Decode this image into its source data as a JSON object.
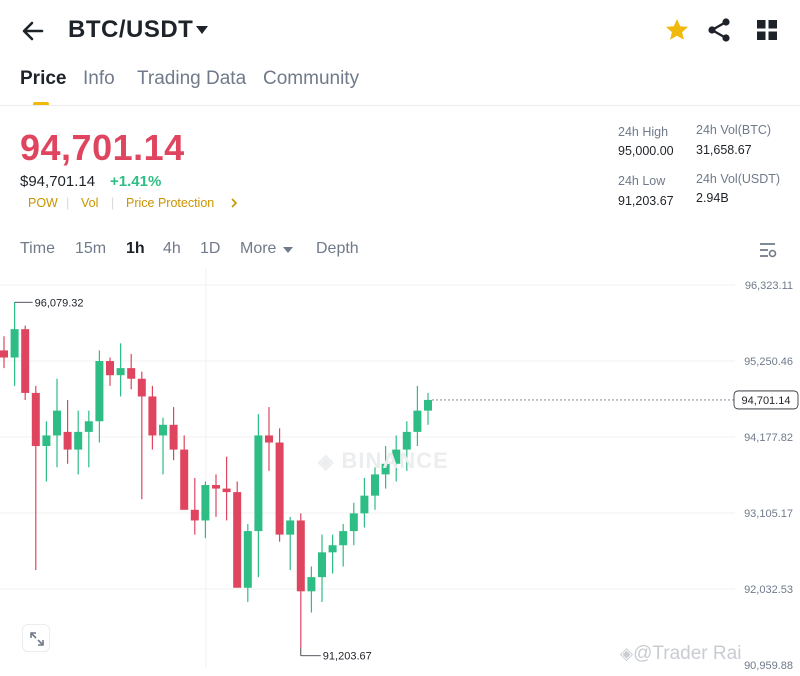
{
  "header": {
    "pair": "BTC/USDT",
    "back_icon": "arrow-left-icon",
    "favorite_icon": "star-icon",
    "favorite_color": "#f0b90b",
    "share_icon": "share-icon",
    "menu_icon": "grid-icon"
  },
  "tabs": [
    "Price",
    "Info",
    "Trading Data",
    "Community"
  ],
  "active_tab": "Price",
  "price": {
    "last": "94,701.14",
    "usd": "$94,701.14",
    "change": "+1.41%",
    "tags": [
      "POW",
      "Vol",
      "Price Protection"
    ]
  },
  "stats": {
    "high_label": "24h High",
    "high_value": "95,000.00",
    "vol_btc_label": "24h Vol(BTC)",
    "vol_btc_value": "31,658.67",
    "low_label": "24h Low",
    "low_value": "91,203.67",
    "vol_usdt_label": "24h Vol(USDT)",
    "vol_usdt_value": "2.94B"
  },
  "intervals": [
    "Time",
    "15m",
    "1h",
    "4h",
    "1D",
    "More",
    "Depth"
  ],
  "active_interval": "1h",
  "colors": {
    "up": "#2ebd85",
    "down": "#e0455f",
    "accent": "#f0b90b"
  },
  "chart": {
    "axis_labels": [
      "96,323.11",
      "95,250.46",
      "94,177.82",
      "93,105.17",
      "92,032.53",
      "90,959.88"
    ],
    "axis_values": [
      96323.11,
      95250.46,
      94177.82,
      93105.17,
      92032.53,
      90959.88
    ],
    "current_price": "94,701.14",
    "current_value": 94701.14,
    "max_label": "96,079.32",
    "max_value": 96079.32,
    "min_label": "91,203.67",
    "min_value": 91203.67,
    "watermark": "BINANCE",
    "author_watermark": "@Trader Rai",
    "candles": [
      [
        95400,
        95600,
        95150,
        95300
      ],
      [
        95300,
        96079.32,
        94900,
        95700
      ],
      [
        95700,
        95750,
        94700,
        94800
      ],
      [
        94800,
        94900,
        92300,
        94050
      ],
      [
        94050,
        94400,
        93550,
        94200
      ],
      [
        94200,
        95000,
        93750,
        94550
      ],
      [
        94250,
        94700,
        93800,
        94000
      ],
      [
        94000,
        94550,
        93650,
        94250
      ],
      [
        94250,
        94550,
        93750,
        94400
      ],
      [
        94400,
        95400,
        94100,
        95250
      ],
      [
        95250,
        95300,
        94900,
        95050
      ],
      [
        95050,
        95500,
        94750,
        95150
      ],
      [
        95150,
        95350,
        94850,
        95000
      ],
      [
        95000,
        95100,
        93300,
        94750
      ],
      [
        94750,
        94900,
        94000,
        94200
      ],
      [
        94200,
        94450,
        93650,
        94350
      ],
      [
        94350,
        94600,
        93850,
        94000
      ],
      [
        94000,
        94200,
        93200,
        93150
      ],
      [
        93150,
        93600,
        92800,
        93000
      ],
      [
        93000,
        93550,
        92750,
        93500
      ],
      [
        93500,
        93650,
        93050,
        93450
      ],
      [
        93450,
        93900,
        93000,
        93400
      ],
      [
        93400,
        93550,
        92500,
        92050
      ],
      [
        92050,
        92950,
        91850,
        92850
      ],
      [
        92850,
        94500,
        92200,
        94200
      ],
      [
        94200,
        94600,
        93700,
        94100
      ],
      [
        94100,
        94300,
        92700,
        92800
      ],
      [
        92800,
        93050,
        92300,
        93000
      ],
      [
        93000,
        93100,
        91203.67,
        92000
      ],
      [
        92000,
        92350,
        91700,
        92200
      ],
      [
        92200,
        92800,
        91850,
        92550
      ],
      [
        92550,
        92800,
        92250,
        92650
      ],
      [
        92650,
        92950,
        92350,
        92850
      ],
      [
        92850,
        93250,
        92650,
        93100
      ],
      [
        93100,
        93600,
        92900,
        93350
      ],
      [
        93350,
        93750,
        93150,
        93650
      ],
      [
        93650,
        94050,
        93450,
        93800
      ],
      [
        93800,
        94200,
        93550,
        94000
      ],
      [
        94000,
        94400,
        93700,
        94250
      ],
      [
        94250,
        94900,
        94050,
        94550
      ],
      [
        94550,
        94800,
        94350,
        94701.14
      ]
    ]
  }
}
